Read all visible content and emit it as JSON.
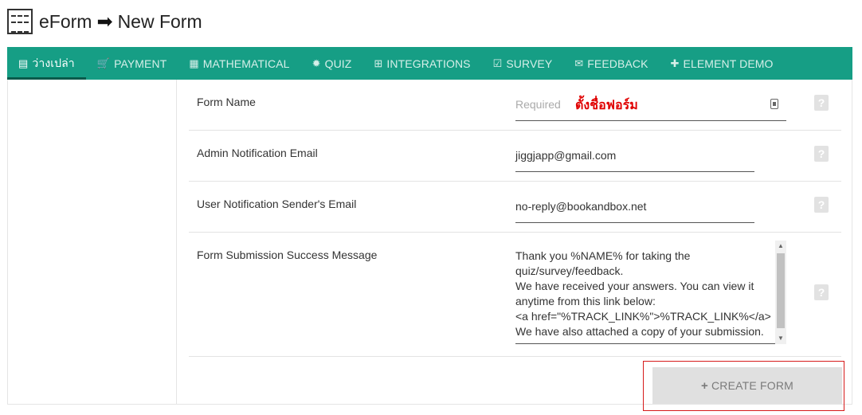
{
  "header": {
    "app_name": "eForm",
    "arrow": "➡",
    "page_name": "New Form"
  },
  "nav": {
    "items": [
      {
        "label": "ว่างเปล่า",
        "icon": "file-icon",
        "glyph": "▤",
        "active": true
      },
      {
        "label": "PAYMENT",
        "icon": "cart-icon",
        "glyph": "🛒"
      },
      {
        "label": "MATHEMATICAL",
        "icon": "calculator-icon",
        "glyph": "▦"
      },
      {
        "label": "QUIZ",
        "icon": "gear-icon",
        "glyph": "✹"
      },
      {
        "label": "INTEGRATIONS",
        "icon": "plus-square-icon",
        "glyph": "⊞"
      },
      {
        "label": "SURVEY",
        "icon": "clipboard-check-icon",
        "glyph": "☑"
      },
      {
        "label": "FEEDBACK",
        "icon": "envelope-icon",
        "glyph": "✉"
      },
      {
        "label": "ELEMENT DEMO",
        "icon": "puzzle-icon",
        "glyph": "✚"
      }
    ]
  },
  "form": {
    "form_name": {
      "label": "Form Name",
      "placeholder": "Required",
      "annotation": "ตั้งชื่อฟอร์ม"
    },
    "admin_email": {
      "label": "Admin Notification Email",
      "value": "jiggjapp@gmail.com"
    },
    "sender_email": {
      "label": "User Notification Sender's Email",
      "value": "no-reply@bookandbox.net"
    },
    "success_message": {
      "label": "Form Submission Success Message",
      "value": "Thank you %NAME% for taking the\nquiz/survey/feedback.\nWe have received your answers. You can view it\nanytime from this link below:\n<a href=\"%TRACK_LINK%\">%TRACK_LINK%</a>\nWe have also attached a copy of your submission."
    },
    "help_glyph": "?"
  },
  "actions": {
    "create_plus": "+",
    "create_label": "CREATE FORM"
  },
  "colors": {
    "nav_bg": "#169e85",
    "highlight_border": "#d61a1a",
    "annotation": "#e00000"
  }
}
